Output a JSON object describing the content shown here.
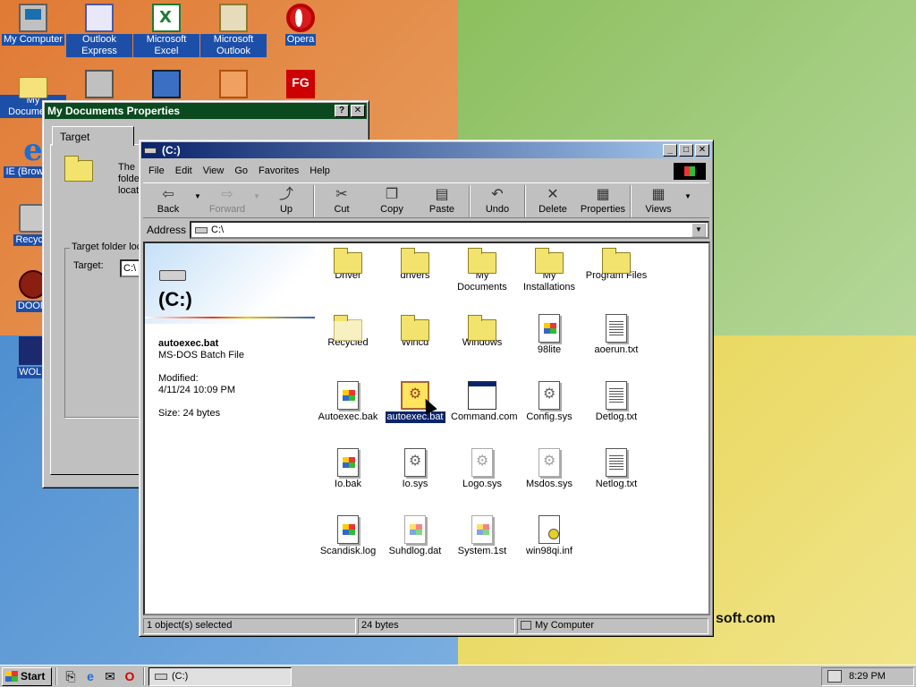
{
  "desktop": {
    "icons": [
      {
        "label": "My Computer"
      },
      {
        "label": "Outlook Express"
      },
      {
        "label": "Microsoft Excel"
      },
      {
        "label": "Microsoft Outlook"
      },
      {
        "label": "Opera"
      },
      {
        "label": "My Documents"
      },
      {
        "label": "IE (Browser)"
      },
      {
        "label": "Recycle"
      },
      {
        "label": "DOOM"
      },
      {
        "label": "WOLF"
      }
    ],
    "wallpaper_text": "soft.com"
  },
  "props_dialog": {
    "title": "My Documents Properties",
    "help_btn": "?",
    "close_btn": "✕",
    "tab": "Target",
    "description": "The folde locat",
    "group_title": "Target folder loc",
    "target_label": "Target:",
    "target_value": "C:\\"
  },
  "explorer": {
    "title": "(C:)",
    "menu": [
      "File",
      "Edit",
      "View",
      "Go",
      "Favorites",
      "Help"
    ],
    "toolbar": {
      "back": "Back",
      "forward": "Forward",
      "up": "Up",
      "cut": "Cut",
      "copy": "Copy",
      "paste": "Paste",
      "undo": "Undo",
      "delete": "Delete",
      "properties": "Properties",
      "views": "Views"
    },
    "address_label": "Address",
    "address_value": "C:\\",
    "webview": {
      "drive_title": "(C:)",
      "file_name": "autoexec.bat",
      "file_type": "MS-DOS Batch File",
      "modified_label": "Modified:",
      "modified_value": "4/11/24 10:09 PM",
      "size": "Size: 24 bytes"
    },
    "files": [
      {
        "name": "Driver",
        "icon": "folder"
      },
      {
        "name": "drivers",
        "icon": "folder"
      },
      {
        "name": "My Documents",
        "icon": "folder"
      },
      {
        "name": "My Installations",
        "icon": "folder"
      },
      {
        "name": "Program Files",
        "icon": "folder"
      },
      {
        "name": "Recycled",
        "icon": "folder-ghost"
      },
      {
        "name": "Wincd",
        "icon": "folder"
      },
      {
        "name": "Windows",
        "icon": "folder"
      },
      {
        "name": "98lite",
        "icon": "doc-flag"
      },
      {
        "name": "aoerun.txt",
        "icon": "doc-lines"
      },
      {
        "name": "Autoexec.bak",
        "icon": "doc-flag"
      },
      {
        "name": "autoexec.bat",
        "icon": "batch",
        "selected": true
      },
      {
        "name": "Command.com",
        "icon": "app"
      },
      {
        "name": "Config.sys",
        "icon": "doc-gear"
      },
      {
        "name": "Detlog.txt",
        "icon": "doc-lines"
      },
      {
        "name": "Io.bak",
        "icon": "doc-flag"
      },
      {
        "name": "Io.sys",
        "icon": "doc-gear"
      },
      {
        "name": "Logo.sys",
        "icon": "doc-gear-faint"
      },
      {
        "name": "Msdos.sys",
        "icon": "doc-gear-faint"
      },
      {
        "name": "Netlog.txt",
        "icon": "doc-lines"
      },
      {
        "name": "Scandisk.log",
        "icon": "doc-flag"
      },
      {
        "name": "Suhdlog.dat",
        "icon": "doc-flag-faint"
      },
      {
        "name": "System.1st",
        "icon": "doc-flag-faint"
      },
      {
        "name": "win98qi.inf",
        "icon": "inf"
      }
    ],
    "status": {
      "selection": "1 object(s) selected",
      "size": "24 bytes",
      "zone": "My Computer"
    }
  },
  "taskbar": {
    "start": "Start",
    "task": "(C:)",
    "clock": "8:29 PM"
  }
}
